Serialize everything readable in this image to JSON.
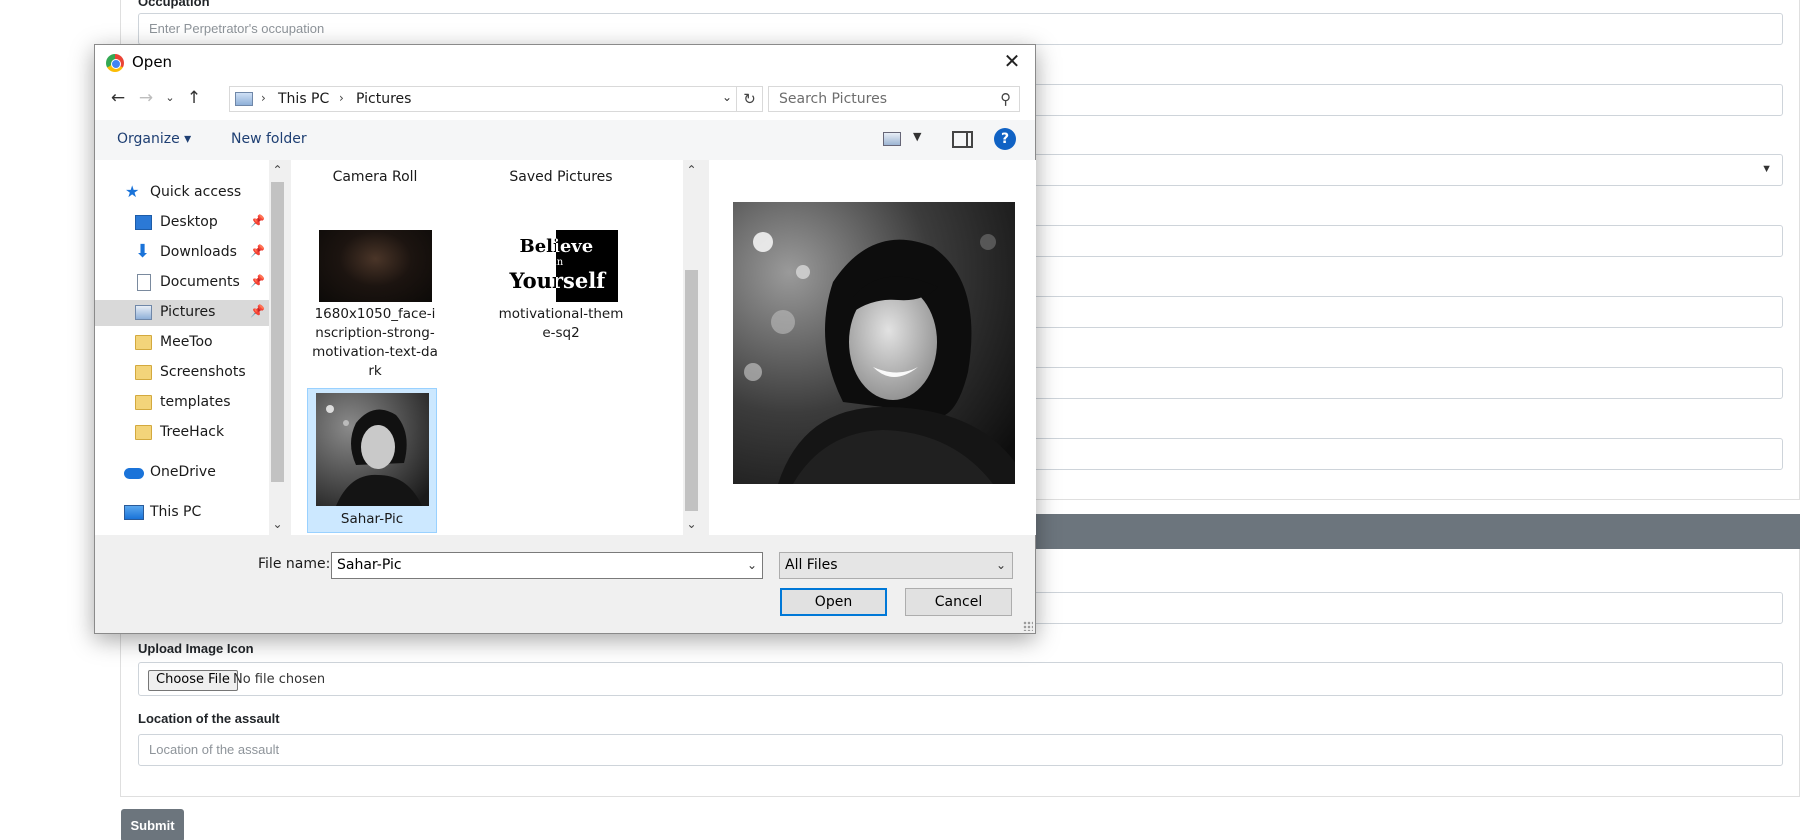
{
  "form": {
    "occupation_label": "Occupation",
    "occupation_placeholder": "Enter Perpetrator's occupation",
    "upload_label": "Upload Image Icon",
    "choose_file": "Choose File",
    "no_file": "No file chosen",
    "location_label": "Location of the assault",
    "location_placeholder": "Location of the assault",
    "submit": "Submit"
  },
  "dialog": {
    "title": "Open",
    "breadcrumbs": [
      "This PC",
      "Pictures"
    ],
    "search_placeholder": "Search Pictures",
    "toolbar": {
      "organize": "Organize ▾",
      "new_folder": "New folder"
    },
    "nav_items": [
      {
        "label": "Quick access",
        "icon": "star-icon",
        "pinned": false
      },
      {
        "label": "Desktop",
        "icon": "desktop-icon",
        "pinned": true
      },
      {
        "label": "Downloads",
        "icon": "download-icon",
        "pinned": true
      },
      {
        "label": "Documents",
        "icon": "document-icon",
        "pinned": true
      },
      {
        "label": "Pictures",
        "icon": "pictures-icon",
        "pinned": true,
        "selected": true
      },
      {
        "label": "MeeToo",
        "icon": "folder-icon"
      },
      {
        "label": "Screenshots",
        "icon": "folder-icon"
      },
      {
        "label": "templates",
        "icon": "folder-icon"
      },
      {
        "label": "TreeHack",
        "icon": "folder-icon"
      },
      {
        "label": "OneDrive",
        "icon": "cloud-icon"
      },
      {
        "label": "This PC",
        "icon": "computer-icon"
      }
    ],
    "folders": [
      "Camera Roll",
      "Saved Pictures"
    ],
    "files": [
      {
        "name": "1680x1050_face-inscription-strong-motivation-text-dark"
      },
      {
        "name": "motivational-theme-sq2",
        "thumb_text": [
          "Believe",
          "in",
          "Yourself"
        ]
      },
      {
        "name": "Sahar-Pic",
        "selected": true
      }
    ],
    "file_name_label": "File name:",
    "file_name_value": "Sahar-Pic",
    "file_type": "All Files",
    "open_button": "Open",
    "cancel_button": "Cancel"
  }
}
